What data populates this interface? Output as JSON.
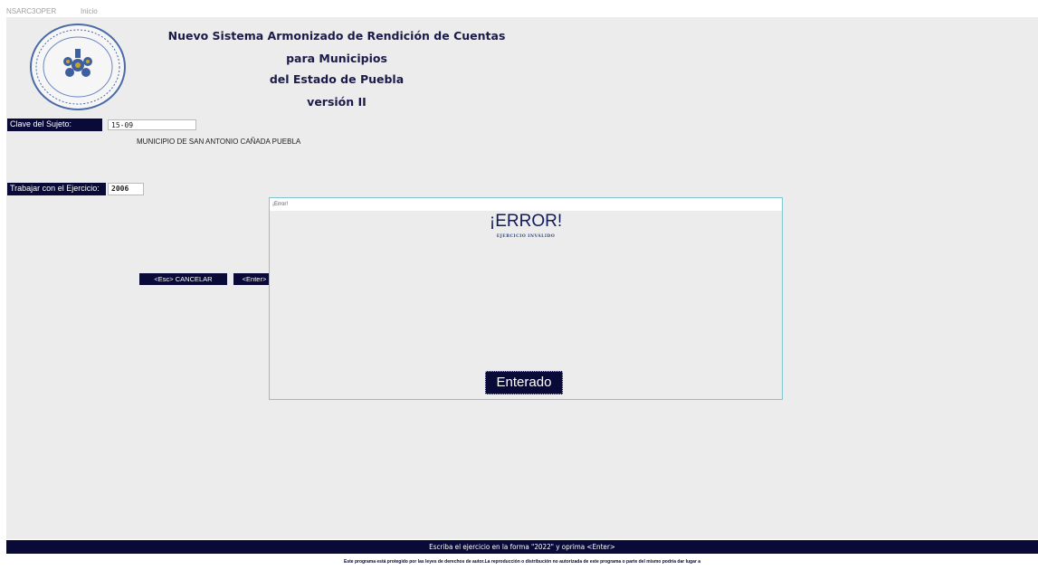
{
  "titlebar": {
    "app_name": "NSARC3OPER",
    "menu": "Inicio"
  },
  "logo": {
    "top_text": "PUEBLA",
    "bottom_text": "NSARC II"
  },
  "header": {
    "line1": "Nuevo Sistema Armonizado de Rendición de Cuentas",
    "line2": "para Municipios",
    "line3": "del Estado de Puebla",
    "line4": "versión II"
  },
  "form": {
    "clave_label": "Clave del Sujeto:",
    "clave_value": "15-09",
    "municipio": "MUNICIPIO DE SAN ANTONIO CAÑADA PUEBLA",
    "ejercicio_label": "Trabajar con el Ejercicio:",
    "ejercicio_value": "2006"
  },
  "buttons": {
    "cancel": "<Esc> CANCELAR",
    "enter": "<Enter>"
  },
  "dialog": {
    "title": "¡Error!",
    "heading": "¡ERROR!",
    "message": "EJERCICIO INVÁLIDO",
    "ok": "Enterado"
  },
  "status": {
    "hint": "Escriba el ejercicio en la forma \"2022\" y oprima <Enter>",
    "legal": "Este programa está protegido por las leyes de derechos de autor.La reproducción o distribución no autorizada de este programa o parte del mismo podría dar lugar a"
  },
  "colors": {
    "navy": "#0a0a38",
    "panel": "#ececec",
    "dialog_border": "#7fc7cd"
  }
}
